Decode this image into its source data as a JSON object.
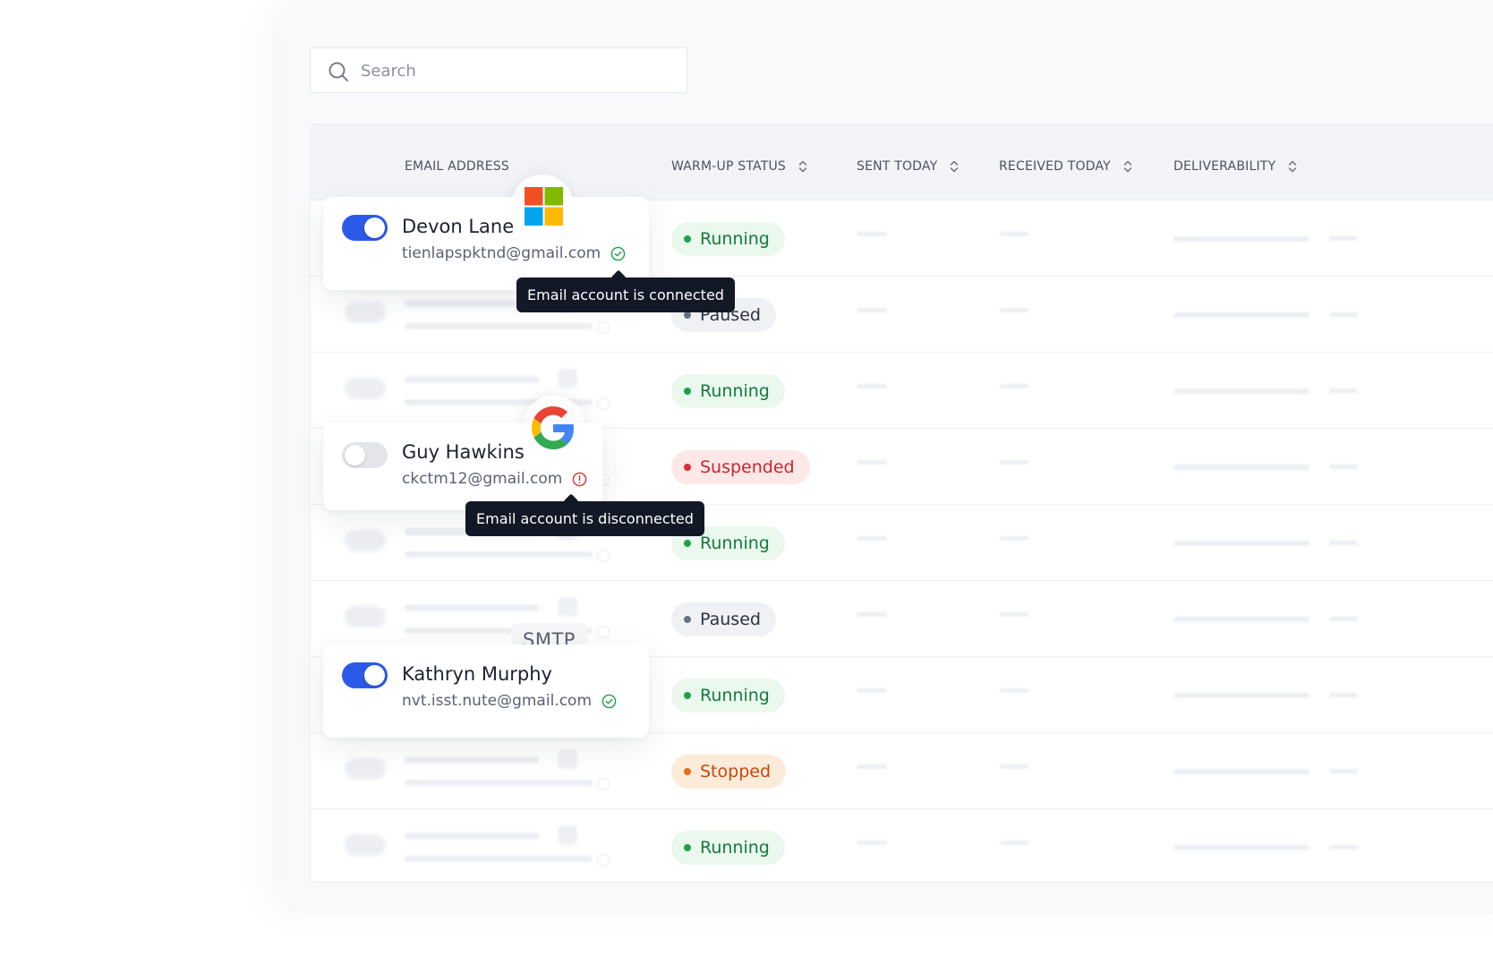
{
  "search": {
    "placeholder": "Search",
    "value": ""
  },
  "table": {
    "columns": {
      "email": "EMAIL ADDRESS",
      "warmup": "WARM-UP STATUS",
      "sent": "SENT TODAY",
      "received": "RECEIVED TODAY",
      "deliverability": "DELIVERABILITY"
    },
    "rows": [
      {
        "status": "Running",
        "kind": "running"
      },
      {
        "status": "Paused",
        "kind": "paused"
      },
      {
        "status": "Running",
        "kind": "running"
      },
      {
        "status": "Suspended",
        "kind": "suspended"
      },
      {
        "status": "Running",
        "kind": "running"
      },
      {
        "status": "Paused",
        "kind": "paused"
      },
      {
        "status": "Running",
        "kind": "running"
      },
      {
        "status": "Stopped",
        "kind": "stopped"
      },
      {
        "status": "Running",
        "kind": "running"
      }
    ]
  },
  "accounts": [
    {
      "name": "Devon Lane",
      "email": "tienlapspktnd@gmail.com",
      "enabled": true,
      "provider": "microsoft-icon",
      "connected": true,
      "tooltip": "Email account is connected"
    },
    {
      "name": "Guy Hawkins",
      "email": "ckctm12@gmail.com",
      "enabled": false,
      "provider": "google-icon",
      "connected": false,
      "tooltip": "Email account is disconnected"
    },
    {
      "name": "Kathryn Murphy",
      "email": "nvt.isst.nute@gmail.com",
      "enabled": true,
      "provider": "smtp",
      "provider_label": "SMTP",
      "connected": true
    }
  ],
  "colors": {
    "accent": "#2b5ae8",
    "running": "#1aa34a",
    "paused": "#6b7080",
    "suspended": "#dc2f33",
    "stopped": "#ea6a1c",
    "tooltip": "#121826"
  }
}
